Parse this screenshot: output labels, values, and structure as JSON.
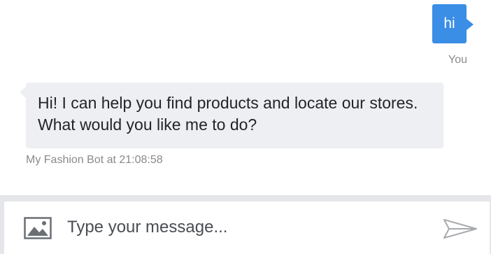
{
  "user_message": {
    "text": "hi",
    "sender": "You",
    "bubble_color": "#3a8ee6"
  },
  "bot_message": {
    "text": "Hi! I can help you find products and locate our stores. What would you like me to do?",
    "meta": "My Fashion Bot at 21:08:58",
    "bubble_color": "#edeff2"
  },
  "composer": {
    "placeholder": "Type your message...",
    "attach_icon": "image-icon",
    "send_icon": "send-icon"
  }
}
